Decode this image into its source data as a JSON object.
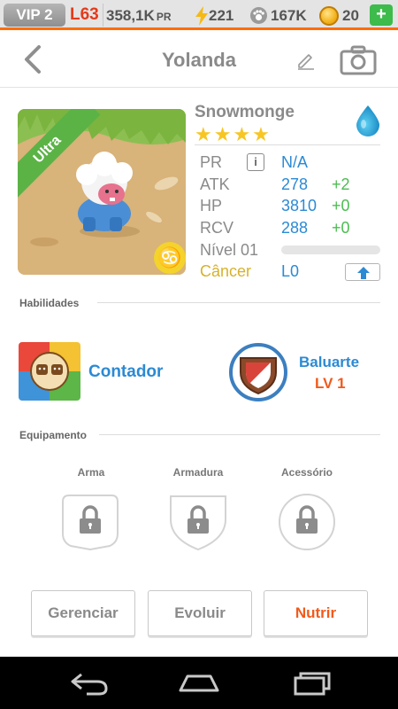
{
  "status_bar": {
    "vip": "VIP 2",
    "level": "L63",
    "pr_value": "358,1K",
    "pr_unit": "PR",
    "energy": "221",
    "paws": "167K",
    "coins": "20",
    "add_label": "+",
    "accent_color": "#ff6d00"
  },
  "header": {
    "back_icon": "chevron-left-icon",
    "title": "Yolanda",
    "edit_icon": "pencil-icon",
    "camera_icon": "camera-icon"
  },
  "monster": {
    "rarity": "Ultra",
    "name": "Snowmonge",
    "stars": "★★★★",
    "star_count": 4,
    "element_icon": "water-drop-icon",
    "zodiac_symbol": "♋",
    "stats": [
      {
        "label": "PR",
        "value": "N/A",
        "bonus": ""
      },
      {
        "label": "ATK",
        "value": "278",
        "bonus": "+2"
      },
      {
        "label": "HP",
        "value": "3810",
        "bonus": "+0"
      },
      {
        "label": "RCV",
        "value": "288",
        "bonus": "+0"
      }
    ],
    "info_label": "i",
    "level_label": "Nível 01",
    "xp_fraction": 0,
    "zodiac_label": "Câncer",
    "zodiac_level": "L0"
  },
  "skills": {
    "section_title": "Habilidades",
    "items": [
      {
        "name": "Contador",
        "level": "",
        "icon": "cat-faces-icon"
      },
      {
        "name": "Baluarte",
        "level": "LV 1",
        "icon": "shield-icon"
      }
    ]
  },
  "equipment": {
    "section_title": "Equipamento",
    "slots": [
      {
        "label": "Arma",
        "icon": "lock-icon"
      },
      {
        "label": "Armadura",
        "icon": "lock-icon"
      },
      {
        "label": "Acessório",
        "icon": "lock-icon"
      }
    ]
  },
  "actions": {
    "manage": "Gerenciar",
    "evolve": "Evoluir",
    "feed": "Nutrir"
  },
  "navbar": {
    "back_icon": "nav-back-icon",
    "home_icon": "nav-home-icon",
    "recents_icon": "nav-recents-icon"
  }
}
